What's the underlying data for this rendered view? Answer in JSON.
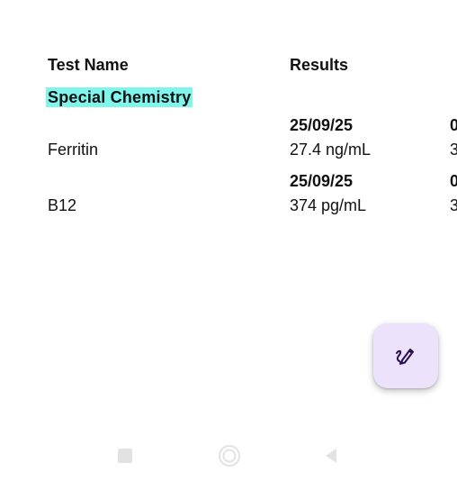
{
  "table": {
    "col_test_name": "Test Name",
    "col_results": "Results",
    "section_label": "Special Chemistry",
    "rows": [
      {
        "date_1": "25/09/25",
        "date_2": "0",
        "name": "Ferritin",
        "value_1": "27.4 ng/mL",
        "value_2": "3"
      },
      {
        "date_1": "25/09/25",
        "date_2": "0",
        "name": "B12",
        "value_1": "374 pg/mL",
        "value_2": "3"
      }
    ]
  },
  "fab": {
    "icon": "pen-scribble-icon",
    "icon_color": "#2a1052",
    "bg_color": "#ece2fb"
  },
  "nav": {
    "recents_icon": "square-icon",
    "home_icon": "circle-icon",
    "back_icon": "triangle-back-icon"
  },
  "colors": {
    "highlight": "#7ff5ec"
  }
}
